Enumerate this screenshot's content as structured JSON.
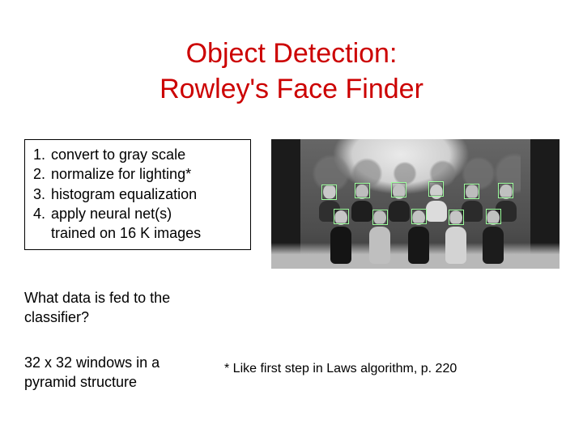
{
  "title": {
    "line1": "Object Detection:",
    "line2": "Rowley's Face Finder"
  },
  "steps": {
    "s1": {
      "num": "1.",
      "text": "convert to gray scale"
    },
    "s2": {
      "num": "2.",
      "text": "normalize for lighting*"
    },
    "s3": {
      "num": "3.",
      "text": "histogram equalization"
    },
    "s4": {
      "num": "4.",
      "text": "apply neural net(s)"
    },
    "s4b": "trained on 16 K images"
  },
  "question": "What data is fed to the classifier?",
  "answer": "32 x 32 windows in a pyramid structure",
  "footnote": "* Like first step in Laws algorithm, p. 220"
}
